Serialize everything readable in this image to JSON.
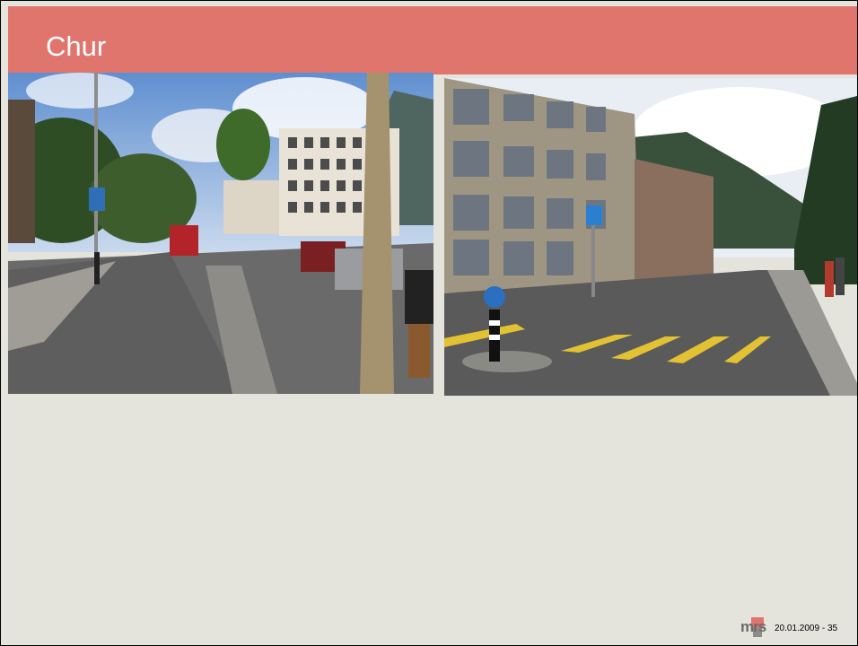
{
  "slide": {
    "title": "Chur",
    "footer": {
      "logo_text": "mrs",
      "date": "20.01.2009",
      "separator": " - ",
      "page_number": "35"
    }
  },
  "photos": [
    {
      "name": "street-photo-left"
    },
    {
      "name": "street-photo-right"
    }
  ]
}
